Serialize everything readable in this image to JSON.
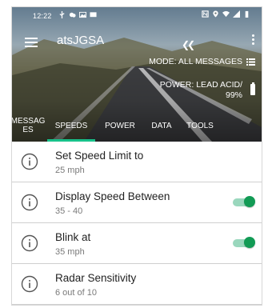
{
  "status_bar": {
    "time": "12:22"
  },
  "app": {
    "title": "atsJGSA"
  },
  "mode": {
    "label": "MODE: ALL MESSAGES"
  },
  "power": {
    "line1": "POWER: LEAD ACID/",
    "line2": "99%"
  },
  "tabs": [
    {
      "label": "MESSAG\nES",
      "active": false
    },
    {
      "label": "SPEEDS",
      "active": true
    },
    {
      "label": "POWER",
      "active": false
    },
    {
      "label": "DATA",
      "active": false
    },
    {
      "label": "TOOLS",
      "active": false
    }
  ],
  "settings": [
    {
      "title": "Set Speed Limit to",
      "value": "25 mph",
      "toggle": false
    },
    {
      "title": "Display Speed Between",
      "value": "35 - 40",
      "toggle": true,
      "on": true
    },
    {
      "title": "Blink at",
      "value": "35 mph",
      "toggle": true,
      "on": true
    },
    {
      "title": "Radar Sensitivity",
      "value": "6 out of 10",
      "toggle": false
    }
  ],
  "colors": {
    "accent": "#18c18a",
    "toggle_on": "#129b55",
    "toggle_track": "#9ad7bd"
  },
  "icons": [
    "menu-icon",
    "back-arrows-icon",
    "more-vert-icon",
    "list-icon",
    "battery-icon",
    "info-icon"
  ]
}
